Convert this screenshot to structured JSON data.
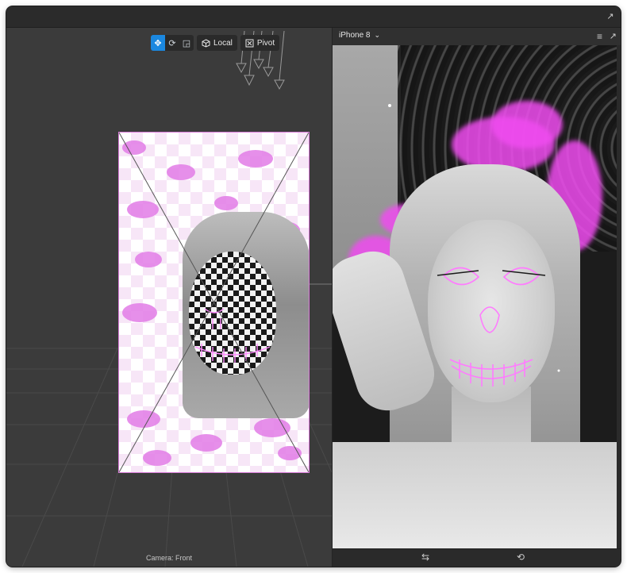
{
  "toolbar": {
    "move_tool": "move-tool",
    "rotate_tool": "rotate-tool",
    "scale_tool": "scale-tool",
    "local_label": "Local",
    "pivot_label": "Pivot"
  },
  "viewport": {
    "camera_label": "Camera: Front"
  },
  "preview": {
    "device_label": "iPhone 8"
  },
  "icons": {
    "popout": "popout-icon",
    "menu": "menu-icon",
    "chevron": "chevron-down-icon",
    "switch_camera": "switch-camera-icon",
    "rotate_device": "rotate-device-icon"
  },
  "colors": {
    "accent": "#1b88e0",
    "neon": "#f04cf0",
    "checker_pink": "#e27be6"
  }
}
